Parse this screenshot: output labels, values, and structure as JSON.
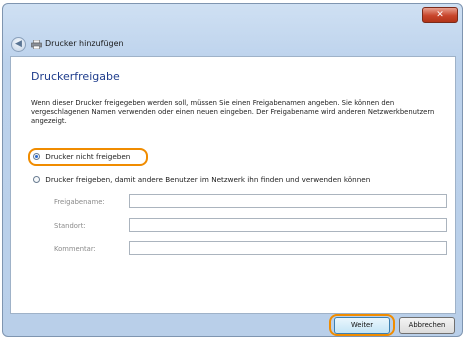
{
  "window": {
    "title": "Drucker hinzufügen",
    "close_label": "✕"
  },
  "page": {
    "heading": "Druckerfreigabe",
    "description": "Wenn dieser Drucker freigegeben werden soll, müssen Sie einen Freigabenamen angeben. Sie können den vergeschlagenen Namen verwenden oder einen neuen eingeben. Der Freigabename wird anderen Netzwerkbenutzern angezeigt."
  },
  "options": {
    "no_share_label": "Drucker nicht freigeben",
    "share_label": "Drucker freigeben, damit andere Benutzer im Netzwerk ihn finden und verwenden können",
    "selected": "no_share"
  },
  "fields": {
    "share_name_label": "Freigabename:",
    "location_label": "Standort:",
    "comment_label": "Kommentar:"
  },
  "buttons": {
    "next_label": "Weiter",
    "cancel_label": "Abbrechen"
  },
  "colors": {
    "highlight": "#f08c00",
    "heading": "#1e3c8c"
  }
}
